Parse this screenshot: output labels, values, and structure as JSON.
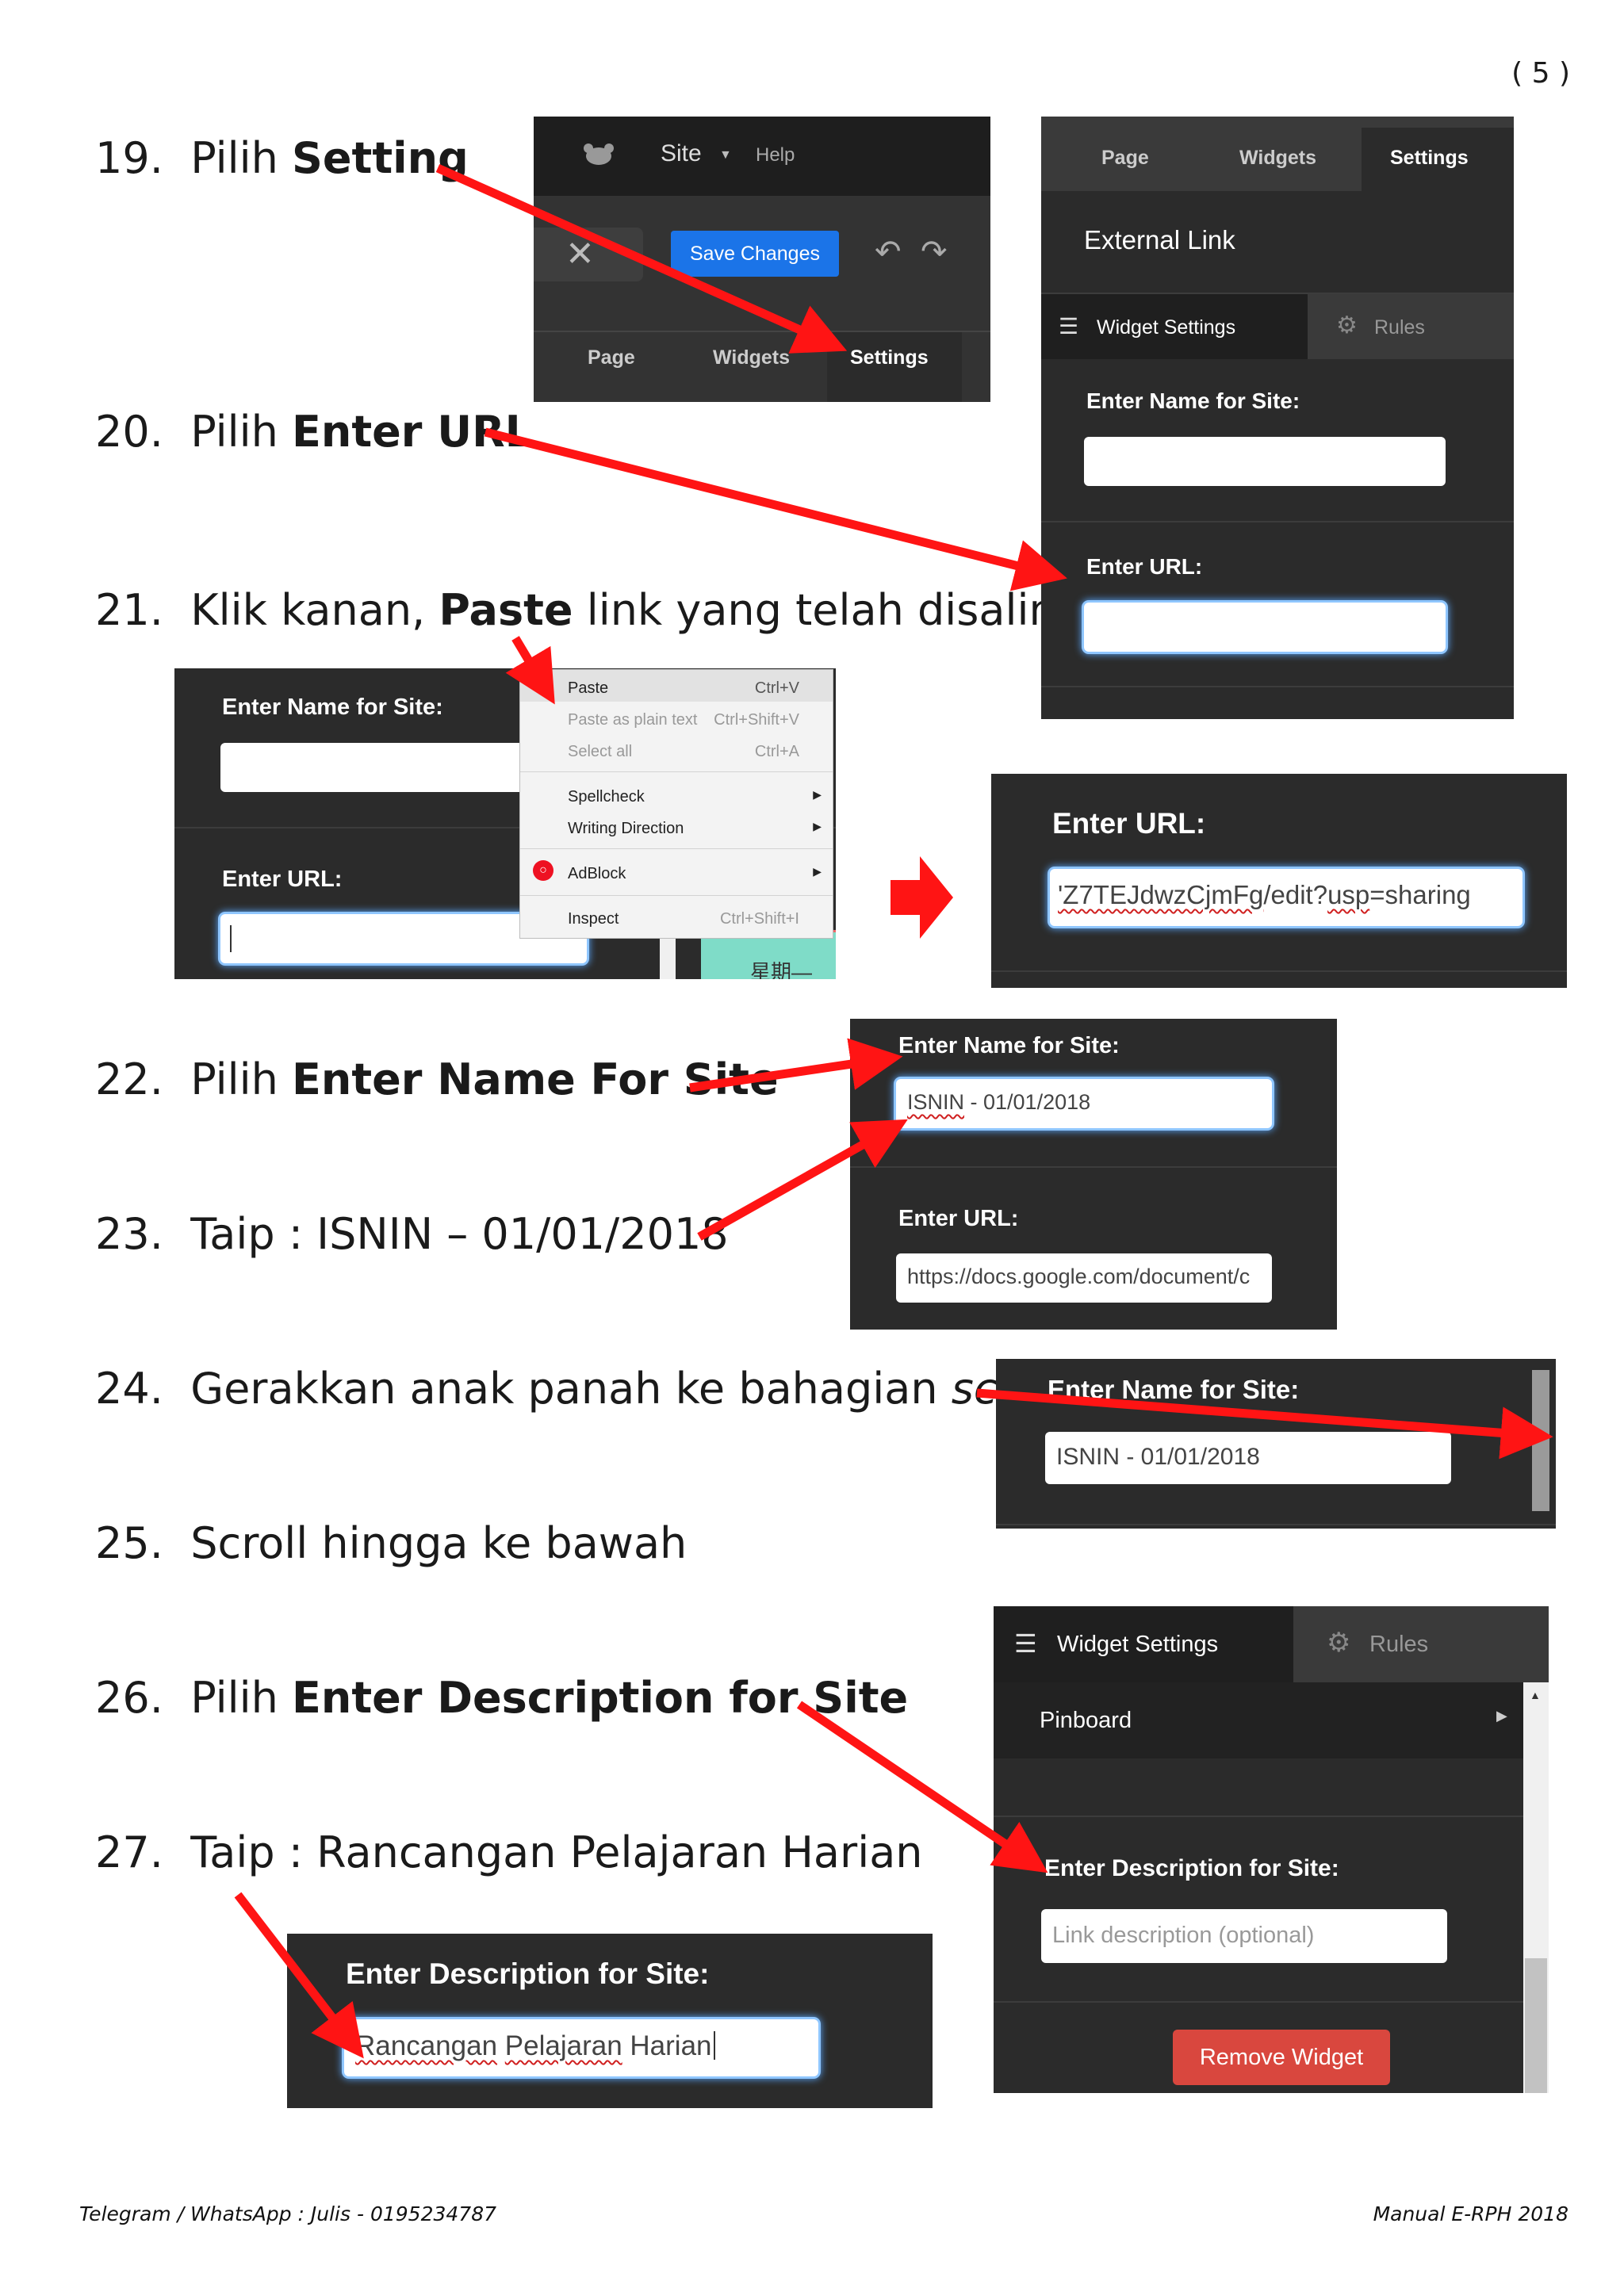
{
  "page_number": "( 5 )",
  "steps": {
    "s19": {
      "num": "19.",
      "pre": "Pilih ",
      "bold": "Setting"
    },
    "s20": {
      "num": "20.",
      "pre": "Pilih ",
      "bold": "Enter URL"
    },
    "s21": {
      "num": "21.",
      "pre": "Klik kanan, ",
      "bold": "Paste",
      "post": " link yang telah disalin"
    },
    "s22": {
      "num": "22.",
      "pre": "Pilih ",
      "bold": "Enter Name For Site"
    },
    "s23": {
      "num": "23.",
      "text": "Taip : ISNIN – 01/01/2018"
    },
    "s24": {
      "num": "24.",
      "pre": "Gerakkan anak panah ke bahagian ",
      "ital": "scroll"
    },
    "s25": {
      "num": "25.",
      "text": "Scroll hingga ke bawah"
    },
    "s26": {
      "num": "26.",
      "pre": "Pilih ",
      "bold": "Enter Description for Site"
    },
    "s27": {
      "num": "27.",
      "text": "Taip : Rancangan Pelajaran Harian"
    }
  },
  "toolbar": {
    "site_menu": "Site",
    "help": "Help",
    "save_changes": "Save Changes",
    "tab_page": "Page",
    "tab_widgets": "Widgets",
    "tab_settings": "Settings"
  },
  "settings_panel": {
    "tab_page": "Page",
    "tab_widgets": "Widgets",
    "tab_settings": "Settings",
    "title": "External Link",
    "widget_settings": "Widget Settings",
    "rules": "Rules",
    "name_label": "Enter Name for Site:",
    "url_label": "Enter URL:"
  },
  "context_menu": {
    "name_label": "Enter Name for Site:",
    "url_label": "Enter URL:",
    "items": {
      "paste": "Paste",
      "paste_key": "Ctrl+V",
      "paste_plain": "Paste as plain text",
      "paste_plain_key": "Ctrl+Shift+V",
      "select_all": "Select all",
      "select_all_key": "Ctrl+A",
      "spellcheck": "Spellcheck",
      "writing_direction": "Writing Direction",
      "adblock": "AdBlock",
      "inspect": "Inspect",
      "inspect_key": "Ctrl+Shift+I"
    },
    "bg_fragment": "星期—"
  },
  "url_result": {
    "label": "Enter URL:",
    "value_a": "'Z7TEJdwzCjmFg",
    "value_b": "/edit?",
    "value_c": "usp",
    "value_d": "=sharing"
  },
  "name_panel": {
    "name_label": "Enter Name for Site:",
    "name_a": "ISNIN",
    "name_b": " - 01/01/2018",
    "url_label": "Enter URL:",
    "url_value": "https://docs.google.com/document/c"
  },
  "scroll_panel": {
    "name_label": "Enter Name for Site:",
    "name_value": "ISNIN - 01/01/2018"
  },
  "description_panel": {
    "widget_settings": "Widget Settings",
    "rules": "Rules",
    "pinboard": "Pinboard",
    "desc_label": "Enter Description for Site:",
    "desc_placeholder": "Link description (optional)",
    "remove_widget": "Remove Widget"
  },
  "description_result": {
    "desc_label": "Enter Description for Site:",
    "w1": "Rancangan",
    "w2": "Pelajaran",
    "w3": "Harian"
  },
  "footer": {
    "left": "Telegram / WhatsApp : Julis - 0195234787",
    "right": "Manual E-RPH 2018"
  },
  "colors": {
    "arrow": "#ff1414",
    "panel": "#2b2b2b",
    "focus_glow": "#5aa8ff",
    "save_blue": "#1b74e8",
    "remove_red": "#d9473e"
  }
}
